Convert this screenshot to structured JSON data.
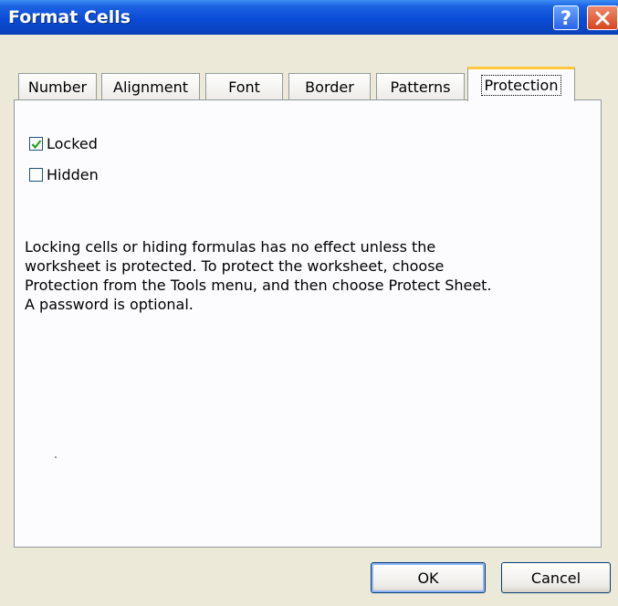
{
  "window": {
    "title": "Format Cells",
    "help_glyph": "?",
    "colors": {
      "titlebar": "#0a4bd6",
      "face": "#ece9d8",
      "panel": "#fcfcfe",
      "active_tab_highlight": "#ffc83c"
    }
  },
  "tabs": [
    {
      "label": "Number",
      "active": false
    },
    {
      "label": "Alignment",
      "active": false
    },
    {
      "label": "Font",
      "active": false
    },
    {
      "label": "Border",
      "active": false
    },
    {
      "label": "Patterns",
      "active": false
    },
    {
      "label": "Protection",
      "active": true
    }
  ],
  "protection": {
    "locked": {
      "label": "Locked",
      "checked": true
    },
    "hidden": {
      "label": "Hidden",
      "checked": false
    },
    "description": "Locking cells or hiding formulas has no effect unless the worksheet is protected. To protect the worksheet, choose Protection from the Tools menu, and then choose Protect Sheet. A password is optional."
  },
  "buttons": {
    "ok": "OK",
    "cancel": "Cancel"
  },
  "icons": {
    "help": "help-icon",
    "close": "close-icon",
    "check": "checkmark-icon"
  }
}
